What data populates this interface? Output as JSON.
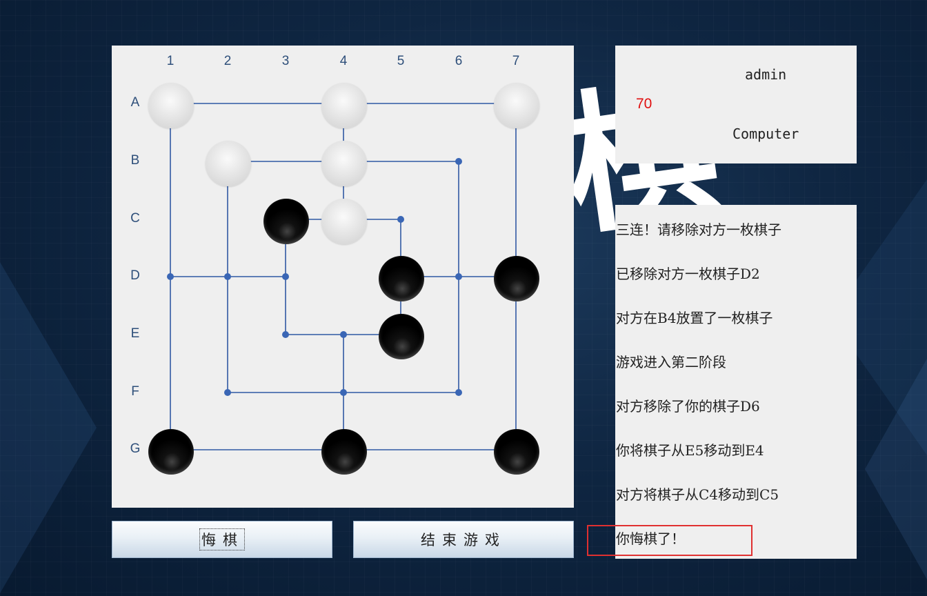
{
  "background": {
    "title_char": "棋"
  },
  "board": {
    "columns": [
      "1",
      "2",
      "3",
      "4",
      "5",
      "6",
      "7"
    ],
    "rows": [
      "A",
      "B",
      "C",
      "D",
      "E",
      "F",
      "G"
    ],
    "line_color": "#2f58a3",
    "node_color": "#3a66b5",
    "pieces": [
      {
        "pos": "A1",
        "color": "white"
      },
      {
        "pos": "A4",
        "color": "white"
      },
      {
        "pos": "A7",
        "color": "white"
      },
      {
        "pos": "B2",
        "color": "white"
      },
      {
        "pos": "B4",
        "color": "white"
      },
      {
        "pos": "C3",
        "color": "black"
      },
      {
        "pos": "C4",
        "color": "white"
      },
      {
        "pos": "D5",
        "color": "black"
      },
      {
        "pos": "D7",
        "color": "black"
      },
      {
        "pos": "E5",
        "color": "black"
      },
      {
        "pos": "G1",
        "color": "black"
      },
      {
        "pos": "G4",
        "color": "black"
      },
      {
        "pos": "G7",
        "color": "black"
      }
    ]
  },
  "buttons": {
    "undo": "悔棋",
    "end_game": "结束游戏"
  },
  "players": {
    "player1": "admin",
    "score": "70",
    "player2": "Computer",
    "score_color": "#e01010"
  },
  "log": [
    "三连！请移除对方一枚棋子",
    "已移除对方一枚棋子D2",
    "对方在B4放置了一枚棋子",
    "游戏进入第二阶段",
    "对方移除了你的棋子D6",
    "你将棋子从E5移动到E4",
    "对方将棋子从C4移动到C5",
    "你悔棋了！"
  ],
  "highlight_color": "#e03030"
}
